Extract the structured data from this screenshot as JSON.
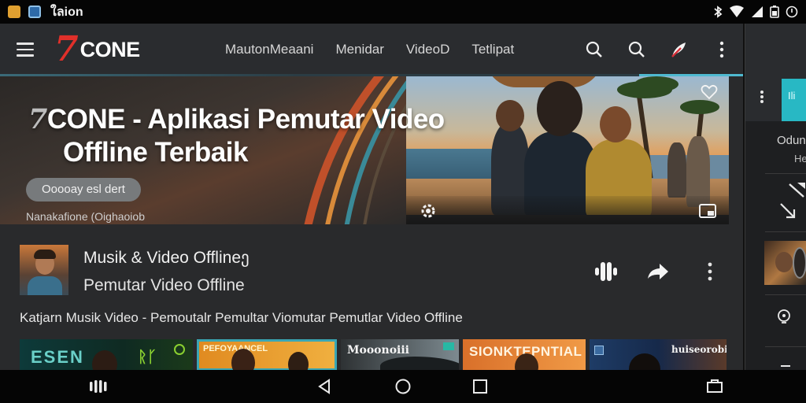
{
  "status_bar": {
    "title": "ใลion"
  },
  "app_bar": {
    "logo_mark": "7",
    "logo_text": "CONE",
    "nav": [
      {
        "label": "MautonMeaani"
      },
      {
        "label": "Menidar"
      },
      {
        "label": "VideoD"
      },
      {
        "label": "Tetlipat"
      }
    ],
    "icons": [
      "search-icon",
      "search-icon",
      "feather-icon",
      "kebab-menu-icon"
    ]
  },
  "hero": {
    "title_line1": "CONE - Aplikasi Pemutar Video",
    "title_line2": "Offline Terbaik",
    "title_mark": "7",
    "chip_label": "Ooooay esl dert",
    "subtitle": "Nanakafione (Oighaoiob",
    "icons": [
      "heart-icon",
      "settings-icon",
      "picture-in-picture-icon"
    ]
  },
  "channel": {
    "line1": "Musik & Video Offlineე",
    "line2": "Pemutar Video Offline",
    "icons": [
      "audio-wave-icon",
      "share-icon",
      "more-icon"
    ]
  },
  "playlist_text": "Katjarn Musik Video - Pemoutalr Pemultar Viomutar Pemutlar Video Offline",
  "thumbnails": [
    {
      "label": "ESEN"
    },
    {
      "label": "PEFOYAANCEL"
    },
    {
      "label": "Mooonoiii"
    },
    {
      "label": "SIONKTEPNTIAL"
    },
    {
      "label": "huiseorobie"
    }
  ],
  "side_panel": {
    "tag": "Ili",
    "text1": "Odun",
    "text2": "He"
  },
  "colors": {
    "accent_cyan": "#28b8c4",
    "logo_red": "#e0302a",
    "app_bar_bg": "#2a2c2f",
    "content_bg": "#292a2c"
  }
}
